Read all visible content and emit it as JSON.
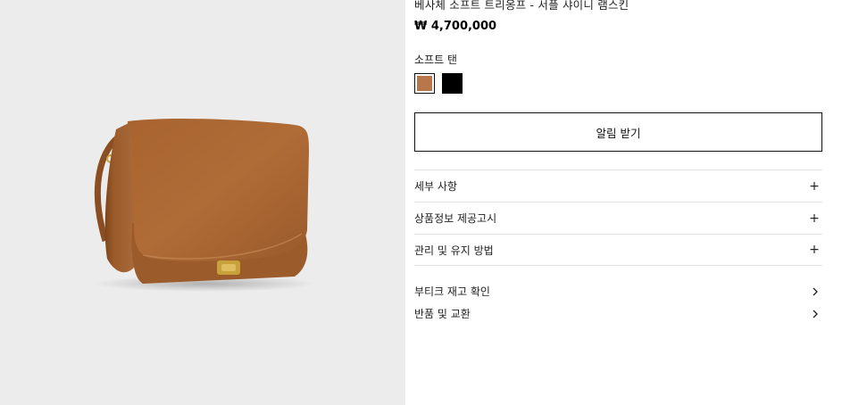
{
  "product": {
    "title": "베사체 소프트 트리옹프 - 서플 샤이니 램스킨",
    "price": "₩ 4,700,000",
    "image_alt": "tan leather flap shoulder bag with gold triomphe clasp"
  },
  "colors": {
    "selected_label": "소프트 탠",
    "swatches": [
      {
        "name": "소프트 탠",
        "hex": "#b7774a",
        "selected": true
      },
      {
        "name": "black",
        "hex": "#000000",
        "selected": false
      }
    ]
  },
  "notify_button": {
    "label": "알림 받기"
  },
  "accordion": [
    {
      "label": "세부 사항",
      "icon": "plus-icon"
    },
    {
      "label": "상품정보 제공고시",
      "icon": "plus-icon"
    },
    {
      "label": "관리 및 유지 방법",
      "icon": "plus-icon"
    }
  ],
  "links": [
    {
      "label": "부티크 재고 확인",
      "icon": "chevron-right-icon"
    },
    {
      "label": "반품 및 교환",
      "icon": "chevron-right-icon"
    }
  ],
  "theme": {
    "image_bg": "#ececec",
    "leather": "#a9683a",
    "gold": "#c9a13a"
  }
}
